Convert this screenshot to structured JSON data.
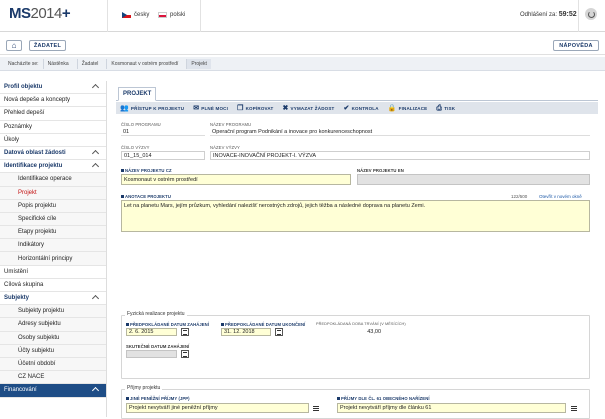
{
  "header": {
    "logo_main": "MS",
    "logo_light": "2014",
    "logo_plus": "+",
    "lang_cz": "česky",
    "lang_pl": "polski",
    "logout_label": "Odhlášení za:",
    "logout_time": "59:52"
  },
  "topbar": {
    "applicant_label": "ŽADATEL",
    "help_label": "NÁPOVĚDA"
  },
  "breadcrumb": {
    "prefix": "Nacházíte se:",
    "items": [
      "Nástěnka",
      "Žadatel",
      "Kosmonaut v ostrém prostředí",
      "Projekt"
    ]
  },
  "sidebar": {
    "items": [
      {
        "label": "Profil objektu",
        "type": "head"
      },
      {
        "label": "Nová depeše a koncepty",
        "type": "top"
      },
      {
        "label": "Přehled depeší",
        "type": "top"
      },
      {
        "label": "Poznámky",
        "type": "top"
      },
      {
        "label": "Úkoly",
        "type": "top"
      },
      {
        "label": "Datová oblast žádosti",
        "type": "head"
      },
      {
        "label": "Identifikace projektu",
        "type": "head"
      },
      {
        "label": "Identifikace operace",
        "type": "sub"
      },
      {
        "label": "Projekt",
        "type": "sub-active"
      },
      {
        "label": "Popis projektu",
        "type": "sub"
      },
      {
        "label": "Specifické cíle",
        "type": "sub"
      },
      {
        "label": "Etapy projektu",
        "type": "sub"
      },
      {
        "label": "Indikátory",
        "type": "sub"
      },
      {
        "label": "Horizontální principy",
        "type": "sub"
      },
      {
        "label": "Umístění",
        "type": "top"
      },
      {
        "label": "Cílová skupina",
        "type": "top"
      },
      {
        "label": "Subjekty",
        "type": "head"
      },
      {
        "label": "Subjekty projektu",
        "type": "sub"
      },
      {
        "label": "Adresy subjektu",
        "type": "sub"
      },
      {
        "label": "Osoby subjektu",
        "type": "sub"
      },
      {
        "label": "Účty subjektu",
        "type": "sub"
      },
      {
        "label": "Účetní období",
        "type": "sub"
      },
      {
        "label": "CZ NACE",
        "type": "sub"
      },
      {
        "label": "Financování",
        "type": "band"
      }
    ]
  },
  "main": {
    "tab_label": "PROJEKT",
    "toolbar": [
      {
        "label": "PŘÍSTUP K PROJEKTU",
        "icon": "people-icon"
      },
      {
        "label": "PLNÉ MOCI",
        "icon": "mail-icon"
      },
      {
        "label": "KOPÍROVAT",
        "icon": "copy-icon"
      },
      {
        "label": "VYMAZAT ŽÁDOST",
        "icon": "x-icon"
      },
      {
        "label": "KONTROLA",
        "icon": "check-icon"
      },
      {
        "label": "FINALIZACE",
        "icon": "lock-icon"
      },
      {
        "label": "TISK",
        "icon": "print-icon"
      }
    ],
    "fields": {
      "program_no_label": "ČÍSLO PROGRAMU",
      "program_no_value": "01",
      "program_name_label": "NÁZEV PROGRAMU",
      "program_name_value": "Operační program Podnikání a inovace pro konkurenceschopnost",
      "call_no_label": "ČÍSLO VÝZVY",
      "call_no_value": "01_15_014",
      "call_name_label": "NÁZEV VÝZVY",
      "call_name_value": "INOVACE-INOVAČNÍ PROJEKT-I. VÝZVA",
      "project_name_cz_label": "NÁZEV PROJEKTU CZ",
      "project_name_cz_value": "Kosmonaut v ostrém prostředí",
      "project_name_en_label": "NÁZEV PROJEKTU EN",
      "project_name_en_value": "",
      "annotation_label": "ANOTACE PROJEKTU",
      "annotation_counter": "122/500",
      "annotation_link": "Otevřít v novém okně",
      "annotation_value": "Let na planetu Mars, jejím průzkum, vyhledání nalezišť nerostných zdrojů, jejich těžba a následné doprava na planetu Zemi.",
      "physical_legend": "Fyzická realizace projektu",
      "start_label": "PŘEDPOKLÁDANÉ DATUM ZAHÁJENÍ",
      "start_value": "2. 6. 2015",
      "end_label": "PŘEDPOKLÁDANÉ DATUM UKONČENÍ",
      "end_value": "31. 12. 2018",
      "duration_label": "PŘEDPOKLÁDANÁ DOBA TRVÁNÍ (V MĚSÍCÍCH)",
      "duration_value": "43,00",
      "actual_start_label": "SKUTEČNÉ DATUM ZAHÁJENÍ",
      "actual_start_value": "",
      "income_legend": "Příjmy projektu",
      "other_income_label": "JINÉ PENĚŽNÍ PŘÍJMY (JPP)",
      "other_income_value": "Projekt nevytváří jiné peněžní příjmy",
      "art61_label": "PŘÍJMY DLE ČL. 61 OBECNÉHO NAŘÍZENÍ",
      "art61_value": "Projekt nevytváří příjmy dle článku 61"
    }
  }
}
